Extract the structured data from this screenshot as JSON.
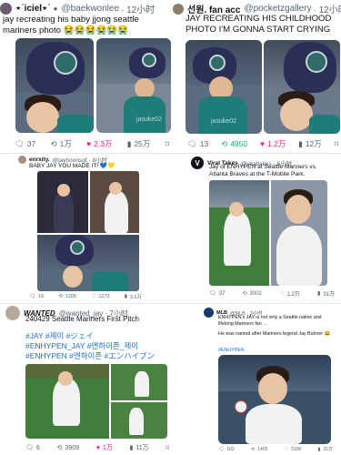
{
  "post1": {
    "display_name": "⋆˙iciel⋆˙",
    "handle": "@baekwonlee",
    "time": "· 12小时",
    "text": "jay recreating his baby jjong seattle mariners photo 😭😭😭😭😭😭",
    "replies": "37",
    "reposts": "1万",
    "likes": "2.3万",
    "views": "25万",
    "watermark": "jasuke02"
  },
  "post2": {
    "display_name": "선원. fan acc",
    "handle": "@pocketzgallery",
    "time": "· 12小时",
    "text": "JAY RECREATING HIS CHILDHOOD PHOTO I'M GONNA START CRYING",
    "replies": "13",
    "reposts": "4950",
    "likes": "1.2万",
    "views": "12万",
    "watermark": "jasuke02"
  },
  "post3": {
    "display_name": "enrxity.",
    "handle": "@jayhoonsgf · 8小时",
    "text": "BABY JAY YOU MADE IT! 💙💛",
    "replies": "10",
    "reposts": "1205",
    "likes": "1273",
    "views": "3.5万"
  },
  "post4": {
    "display_name": "Viral Takes",
    "handle": "@viraltakes · 6小时",
    "text": "Jay of ENHYPEN at Seattle Mariners vs. Atlanta Braves at the T-Mobile Park.",
    "replies": "37",
    "reposts": "3002",
    "likes": "1.2万",
    "views": "31万",
    "logo_letter": "V"
  },
  "post5": {
    "display_name": "WANTED",
    "handle": "@wanted_jay · 7小时",
    "text_line1": "240429 Seattle Mariners First Pitch",
    "hashtags1": "#JAY #제이 #ジェイ",
    "hashtags2": "#ENHYPEN_JAY #엔하이픈_제이",
    "hashtags3": "#ENHYPEN #엔하이픈 #エンハイプン",
    "replies": "6",
    "reposts": "3909",
    "likes": "1万",
    "views": "11万"
  },
  "post6": {
    "display_name": "MLB",
    "handle": "@MLB · 2小时",
    "text_line1": "ENHYPEN's JAY is not only a Seattle native and lifelong Mariners fan ...",
    "text_line2": "He was named after Mariners legend Jay Buhner 😂",
    "hashtags": "#ENHYPEN",
    "replies": "163",
    "reposts": "1405",
    "likes": "5100",
    "views": "31万"
  },
  "colors": {
    "accent_like": "#f91880",
    "accent_repost": "#00ba7c",
    "link": "#1d9bf0",
    "mariners_teal": "#005c5c"
  }
}
